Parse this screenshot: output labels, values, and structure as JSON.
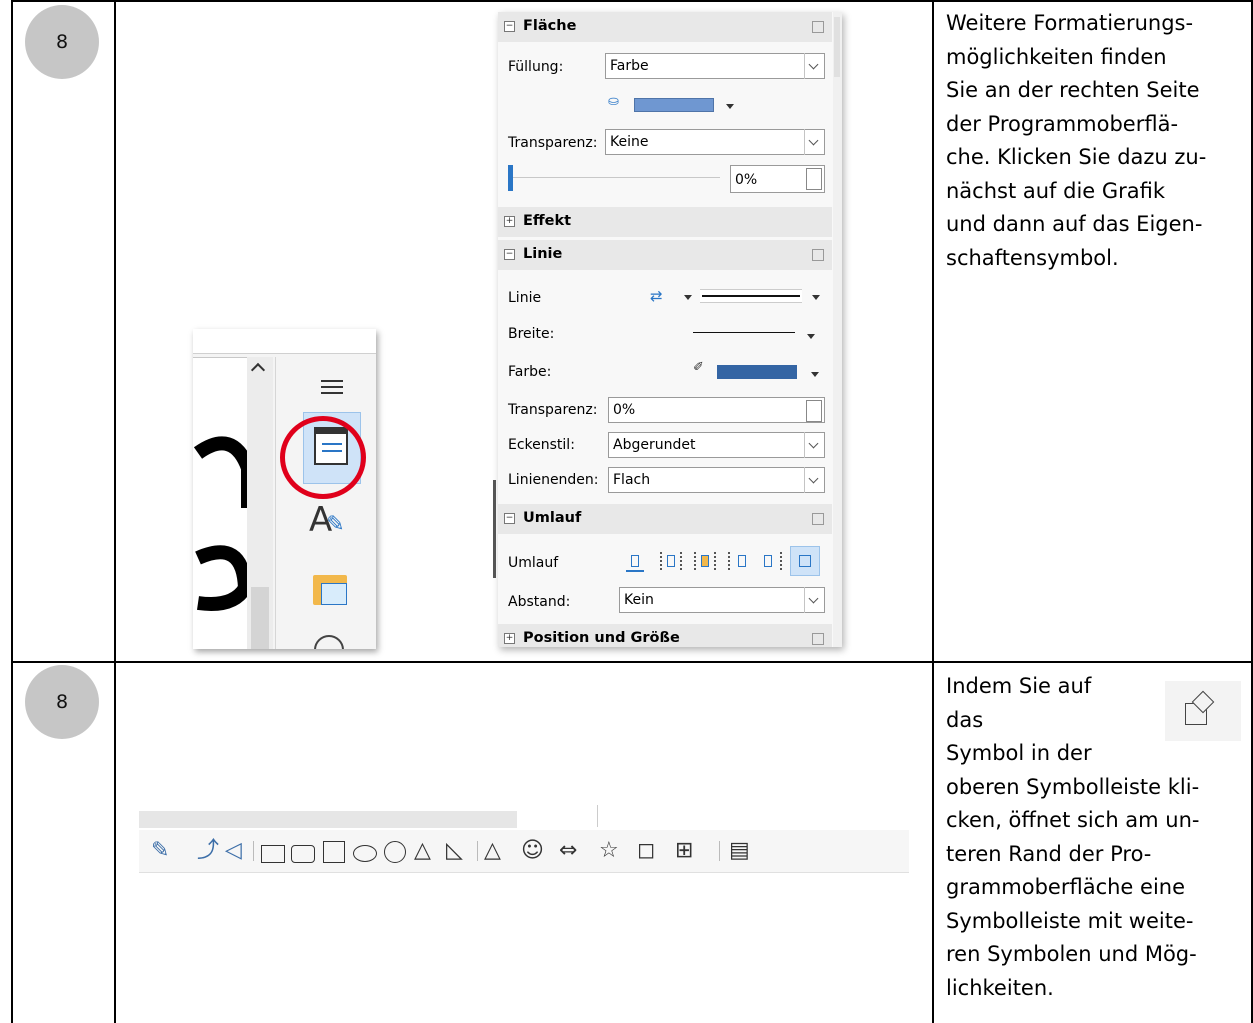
{
  "rows": [
    {
      "step": "8",
      "text_lines": [
        "Weitere Formatierungs-",
        "möglichkeiten finden",
        "Sie an der rechten Seite",
        "der Programmoberflä-",
        "che. Klicken Sie dazu zu-",
        "nächst auf die Grafik",
        "und dann auf das Eigen-",
        "schaftensymbol."
      ]
    },
    {
      "step": "8",
      "text_lines_short": [
        "Indem Sie auf",
        "das",
        "Symbol in der"
      ],
      "text_lines": [
        "oberen Symbolleiste kli-",
        "cken, öffnet sich am un-",
        "teren Rand der Pro-",
        "grammoberfläche eine",
        "Symbolleiste mit weite-",
        "ren Symbolen und Mög-",
        "lichkeiten."
      ]
    }
  ],
  "sidebar": {
    "icons": [
      "menu-icon",
      "properties-icon",
      "styles-icon",
      "gallery-icon",
      "navigator-icon"
    ],
    "highlight_color": "#e0001b"
  },
  "panel": {
    "flaeche": {
      "title": "Fläche",
      "fill_label": "Füllung:",
      "fill_value": "Farbe",
      "fill_color": "#6f97d1",
      "transparency_label": "Transparenz:",
      "transparency_value": "Keine",
      "transparency_percent": "0%"
    },
    "effekt": {
      "title": "Effekt"
    },
    "linie": {
      "title": "Linie",
      "line_label": "Linie",
      "width_label": "Breite:",
      "color_label": "Farbe:",
      "line_color": "#3465a4",
      "transparency_label": "Transparenz:",
      "transparency_value": "0%",
      "corner_label": "Eckenstil:",
      "corner_value": "Abgerundet",
      "caps_label": "Linienenden:",
      "caps_value": "Flach"
    },
    "umlauf": {
      "title": "Umlauf",
      "wrap_label": "Umlauf",
      "spacing_label": "Abstand:",
      "spacing_value": "Kein"
    },
    "position": {
      "title": "Position und Größe"
    }
  },
  "toolbar": {
    "icons": [
      "curve-icon",
      "line-icon",
      "polygon-icon",
      "rectangle-icon",
      "rounded-rectangle-icon",
      "square-icon",
      "ellipse-icon",
      "circle-icon",
      "triangle-icon",
      "right-triangle-icon",
      "basic-shapes-icon",
      "symbol-shapes-icon",
      "arrow-shapes-icon",
      "star-shapes-icon",
      "callout-shapes-icon",
      "flowchart-shapes-icon",
      "text-icon"
    ]
  }
}
